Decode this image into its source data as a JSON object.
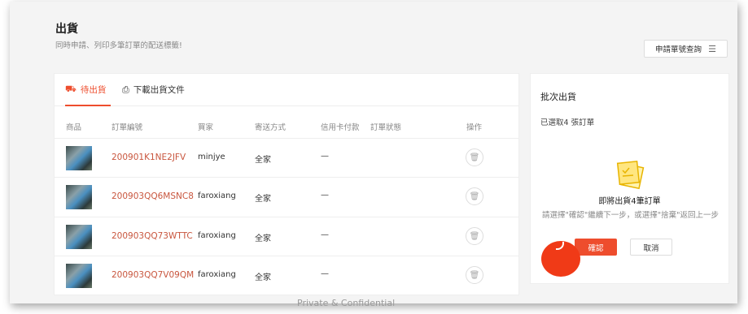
{
  "header": {
    "title": "出貨",
    "subtitle": "同時申請、列印多筆訂單的配送標籤!",
    "query_button": "申請單號查詢"
  },
  "tabs": [
    {
      "label": "待出貨",
      "icon": "package-icon"
    },
    {
      "label": "下載出貨文件",
      "icon": "printer-icon"
    }
  ],
  "table": {
    "headers": [
      "商品",
      "訂單編號",
      "買家",
      "寄送方式",
      "信用卡付款",
      "訂單狀態",
      "操作"
    ],
    "rows": [
      {
        "order": "200901K1NE2JFV",
        "buyer": "minjye",
        "shipping": "全家",
        "card": "—"
      },
      {
        "order": "200903QQ6MSNC8",
        "buyer": "faroxiang",
        "shipping": "全家",
        "card": "—"
      },
      {
        "order": "200903QQ73WTTC",
        "buyer": "faroxiang",
        "shipping": "全家",
        "card": "—"
      },
      {
        "order": "200903QQ7V09QM",
        "buyer": "faroxiang",
        "shipping": "全家",
        "card": "—"
      }
    ]
  },
  "batch": {
    "title": "批次出貨",
    "selected": "已選取4 張訂單",
    "heading": "即將出貨4筆訂單",
    "hint": "請選擇\"確認\"繼續下一步，或選擇\"捨棄\"返回上一步",
    "confirm": "確認",
    "cancel": "取消"
  },
  "footer": {
    "watermark": "Private & Confidential"
  },
  "colors": {
    "accent": "#ee4d2d",
    "order_link": "#c8553d"
  }
}
